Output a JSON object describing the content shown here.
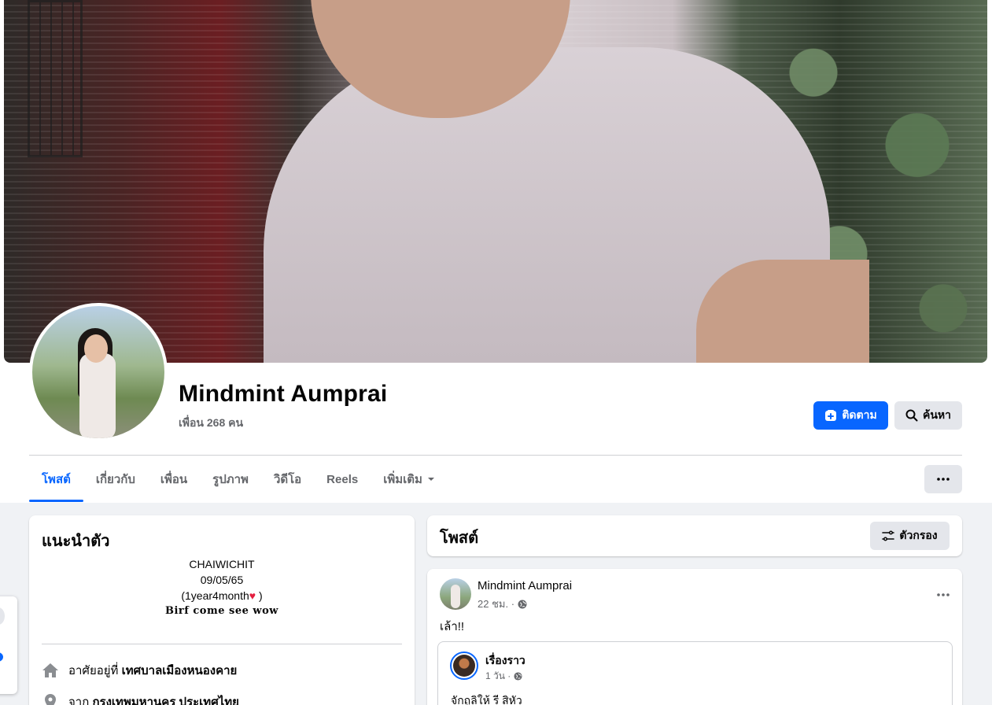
{
  "profile": {
    "name": "Mindmint Aumprai",
    "friends_text": "เพื่อน 268 คน"
  },
  "actions": {
    "follow_label": "ติดตาม",
    "search_label": "ค้นหา"
  },
  "tabs": [
    {
      "label": "โพสต์",
      "active": true
    },
    {
      "label": "เกี่ยวกับ"
    },
    {
      "label": "เพื่อน"
    },
    {
      "label": "รูปภาพ"
    },
    {
      "label": "วิดีโอ"
    },
    {
      "label": "Reels"
    },
    {
      "label": "เพิ่มเติม"
    }
  ],
  "intro": {
    "title": "แนะนำตัว",
    "bio_lines": [
      "CHAIWICHIT",
      "09/05/65",
      "(1year4month",
      ")",
      "Birf come see wow"
    ],
    "lives_in_prefix": "อาศัยอยู่ที่",
    "lives_in_value": "เทศบาลเมืองหนองคาย",
    "from_prefix": "จาก",
    "from_value": "กรุงเทพมหานคร ประเทศไทย"
  },
  "posts_header": {
    "title": "โพสต์",
    "filter_label": "ตัวกรอง"
  },
  "post": {
    "author": "Mindmint Aumprai",
    "time": "22 ชม. ·",
    "text": "เล้า!!",
    "shared": {
      "author": "เรื่องราว",
      "time": "1 วัน ·",
      "text": "จักถูลิให้ รี สิหัว"
    }
  },
  "colors": {
    "accent": "#0866ff",
    "background": "#f0f2f5",
    "secondary_text": "#65676b"
  }
}
